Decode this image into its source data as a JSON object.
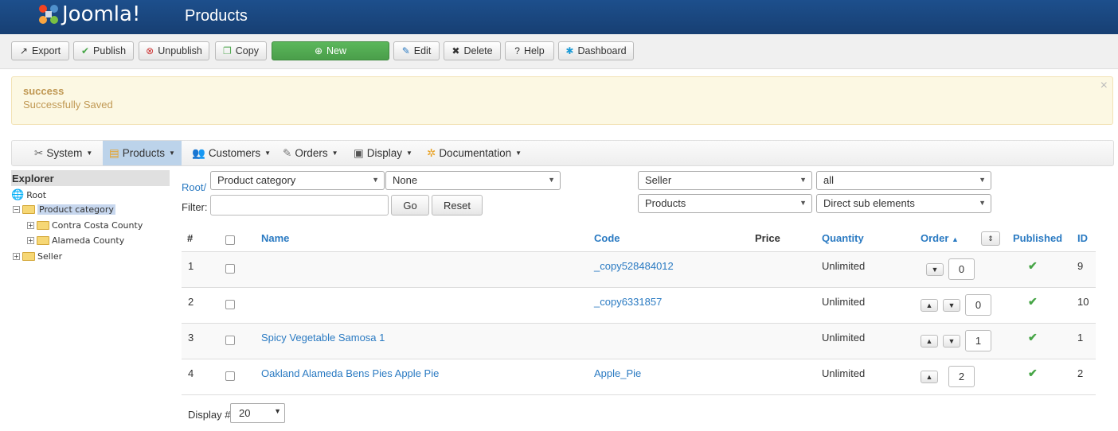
{
  "header": {
    "logo_text": "Joomla!",
    "title": "Products"
  },
  "toolbar": {
    "export": "Export",
    "publish": "Publish",
    "unpublish": "Unpublish",
    "copy": "Copy",
    "new": "New",
    "edit": "Edit",
    "delete": "Delete",
    "help": "Help",
    "dashboard": "Dashboard"
  },
  "alert": {
    "heading": "success",
    "message": "Successfully Saved",
    "close": "×"
  },
  "menu": {
    "system": "System",
    "products": "Products",
    "customers": "Customers",
    "orders": "Orders",
    "display": "Display",
    "documentation": "Documentation"
  },
  "explorer": {
    "heading": "Explorer",
    "root": "Root",
    "product_category": "Product category",
    "contra_costa": "Contra Costa County",
    "alameda": "Alameda County",
    "seller": "Seller"
  },
  "filters": {
    "root_link": "Root/",
    "filter_label": "Filter:",
    "category_select": "Product category",
    "none_select": "None",
    "go": "Go",
    "reset": "Reset",
    "seller_select": "Seller",
    "all_select": "all",
    "products_select": "Products",
    "direct_select": "Direct sub elements"
  },
  "table": {
    "headers": {
      "num": "#",
      "name": "Name",
      "code": "Code",
      "price": "Price",
      "quantity": "Quantity",
      "order": "Order",
      "published": "Published",
      "id": "ID"
    },
    "rows": [
      {
        "num": "1",
        "name": "",
        "code": "_copy528484012",
        "price": "",
        "quantity": "Unlimited",
        "order": "0",
        "id": "9"
      },
      {
        "num": "2",
        "name": "",
        "code": "_copy6331857",
        "price": "",
        "quantity": "Unlimited",
        "order": "0",
        "id": "10"
      },
      {
        "num": "3",
        "name": "Spicy Vegetable Samosa 1",
        "code": "",
        "price": "",
        "quantity": "Unlimited",
        "order": "1",
        "id": "1"
      },
      {
        "num": "4",
        "name": "Oakland Alameda Bens Pies Apple Pie",
        "code": "Apple_Pie",
        "price": "",
        "quantity": "Unlimited",
        "order": "2",
        "id": "2"
      }
    ]
  },
  "footer": {
    "display_label": "Display #",
    "display_value": "20"
  },
  "colors": {
    "header_bg": "#1d4f8c",
    "link": "#2a7ac2",
    "new_button": "#5bb75b",
    "alert_bg": "#fcf8e3",
    "check": "#46a546"
  }
}
